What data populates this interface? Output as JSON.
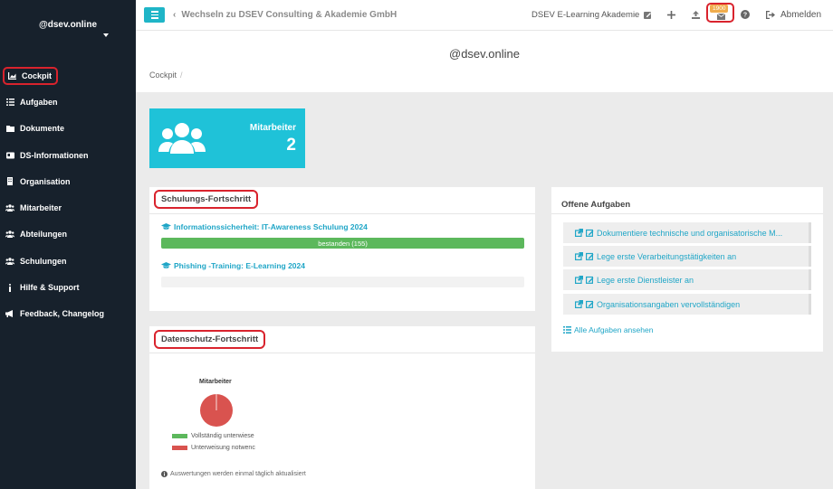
{
  "sidebar": {
    "org_name": "@dsev.online",
    "items": [
      {
        "label": "Cockpit",
        "icon": "chart-area-icon",
        "active": true
      },
      {
        "label": "Aufgaben",
        "icon": "list-icon"
      },
      {
        "label": "Dokumente",
        "icon": "folder-icon"
      },
      {
        "label": "DS-Informationen",
        "icon": "id-card-icon"
      },
      {
        "label": "Organisation",
        "icon": "building-icon"
      },
      {
        "label": "Mitarbeiter",
        "icon": "users-icon"
      },
      {
        "label": "Abteilungen",
        "icon": "users-icon"
      },
      {
        "label": "Schulungen",
        "icon": "users-icon"
      },
      {
        "label": "Hilfe & Support",
        "icon": "info-icon"
      },
      {
        "label": "Feedback, Changelog",
        "icon": "bullhorn-icon"
      }
    ]
  },
  "topbar": {
    "switch_label": "Wechseln zu DSEV Consulting & Akademie GmbH",
    "brand": "DSEV E-Learning Akademie",
    "mail_badge": "1900",
    "logout_label": "Abmelden"
  },
  "page": {
    "title": "@dsev.online",
    "breadcrumb": "Cockpit"
  },
  "stat_tile": {
    "label": "Mitarbeiter",
    "value": "2"
  },
  "schulungen": {
    "title": "Schulungs-Fortschritt",
    "courses": [
      {
        "name": "Informationssicherheit: IT-Awareness Schulung 2024",
        "progress_label": "bestanden (155)",
        "progress": 1.0
      },
      {
        "name": "Phishing -Training: E-Learning 2024",
        "progress_label": "",
        "progress": 0.0
      }
    ]
  },
  "datenschutz": {
    "title": "Datenschutz-Fortschritt",
    "chart_title": "Mitarbeiter",
    "legend": [
      {
        "label": "Vollständig unterwiese",
        "color": "#5cb85c"
      },
      {
        "label": "Unterweisung notwenc",
        "color": "#d9534f"
      }
    ],
    "note": "Auswertungen werden einmal täglich aktualisiert"
  },
  "chart_data": {
    "type": "pie",
    "title": "Mitarbeiter",
    "categories": [
      "Vollständig unterwiese",
      "Unterweisung notwenc"
    ],
    "values": [
      0,
      100
    ],
    "colors": [
      "#5cb85c",
      "#d9534f"
    ]
  },
  "aufgaben": {
    "title": "Offene Aufgaben",
    "tasks": [
      "Dokumentiere technische und organisatorische M...",
      "Lege erste Verarbeitungstätigkeiten an",
      "Lege erste Dienstleister an",
      "Organisationsangaben vervollständigen"
    ],
    "all_link": "Alle Aufgaben ansehen"
  },
  "colors": {
    "sidebar_bg": "#17212c",
    "accent": "#1fc2d8",
    "link": "#20a6c7",
    "success": "#5cb85c",
    "danger": "#d9534f",
    "highlight": "#d9232d"
  }
}
